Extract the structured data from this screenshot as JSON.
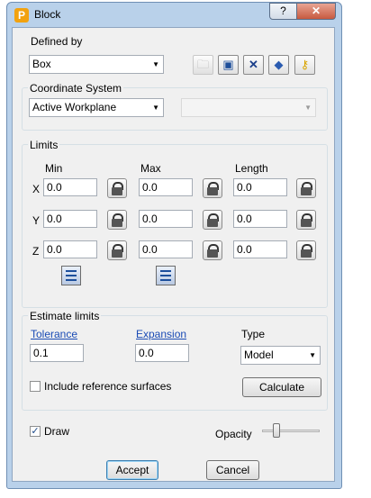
{
  "window": {
    "title": "Block",
    "app_icon_letter": "P",
    "help_glyph": "?",
    "close_glyph": "✕"
  },
  "defined_by": {
    "label": "Defined by",
    "value": "Box",
    "toolbar": [
      {
        "name": "open-folder-icon",
        "glyph": "📂",
        "enabled": false
      },
      {
        "name": "save-icon",
        "glyph": "💾",
        "enabled": true
      },
      {
        "name": "tools-icon",
        "glyph": "🛠",
        "enabled": true
      },
      {
        "name": "model-bucket-icon",
        "glyph": "🛢",
        "enabled": true
      },
      {
        "name": "key-icon",
        "glyph": "🔑",
        "enabled": true
      }
    ]
  },
  "coordinate_system": {
    "label": "Coordinate System",
    "value": "Active Workplane",
    "second_value": ""
  },
  "limits": {
    "label": "Limits",
    "columns": [
      "Min",
      "Max",
      "Length"
    ],
    "rows": [
      {
        "axis": "X",
        "min": "0.0",
        "max": "0.0",
        "length": "0.0"
      },
      {
        "axis": "Y",
        "min": "0.0",
        "max": "0.0",
        "length": "0.0"
      },
      {
        "axis": "Z",
        "min": "0.0",
        "max": "0.0",
        "length": "0.0"
      }
    ]
  },
  "estimate_limits": {
    "label": "Estimate limits",
    "tolerance_label": "Tolerance",
    "tolerance_value": "0.1",
    "expansion_label": "Expansion",
    "expansion_value": "0.0",
    "type_label": "Type",
    "type_value": "Model",
    "include_reference_label": "Include reference surfaces",
    "include_reference_checked": false,
    "calculate_label": "Calculate"
  },
  "draw": {
    "label": "Draw",
    "checked": true,
    "checkmark": "✓"
  },
  "opacity": {
    "label": "Opacity",
    "level_fraction": 0.25
  },
  "buttons": {
    "accept": "Accept",
    "cancel": "Cancel"
  },
  "colors": {
    "title_bar": "#b9d1ea",
    "close_button": "#c75a40",
    "link": "#1a4bb5"
  }
}
